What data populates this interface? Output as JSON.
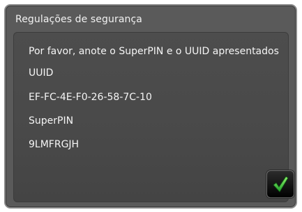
{
  "dialog": {
    "title": "Regulações de segurança",
    "message": "Por favor, anote o SuperPIN e o UUID apresentados",
    "uuid_label": "UUID",
    "uuid_value": "EF-FC-4E-F0-26-58-7C-10",
    "superpin_label": "SuperPIN",
    "superpin_value": "9LMFRGJH"
  },
  "confirm_button": {
    "icon": "checkmark-icon",
    "color": "#37c53a"
  },
  "colors": {
    "frame_background": "#5a5a5a",
    "panel_background": "#4a4a4a",
    "text": "#f5f5f5"
  }
}
